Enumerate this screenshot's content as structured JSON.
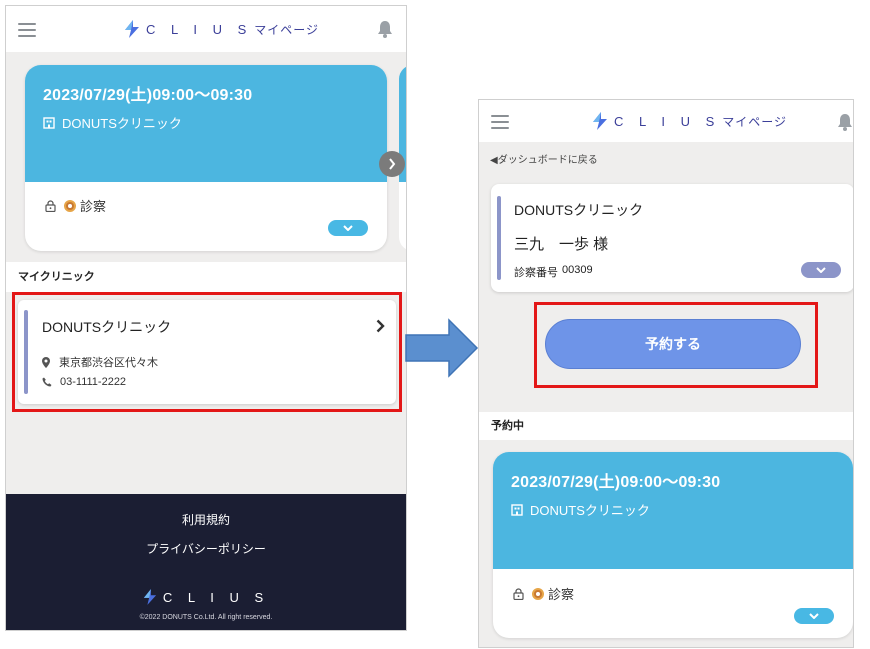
{
  "left_screen": {
    "header": {
      "brand_wordmark": "C L I U S",
      "brand_sub": "マイページ"
    },
    "appointment": {
      "datetime": "2023/07/29(土)09:00～09:30",
      "clinic": "DONUTSクリニック",
      "type": "診察"
    },
    "my_clinic_section": "マイクリニック",
    "clinic_card": {
      "name": "DONUTSクリニック",
      "address": "東京都渋谷区代々木",
      "phone": "03-1111-2222"
    },
    "footer": {
      "terms": "利用規約",
      "privacy": "プライバシーポリシー",
      "logo": "C L I U S",
      "copyright": "©2022 DONUTS Co.Ltd. All right reserved."
    }
  },
  "right_screen": {
    "header": {
      "brand_wordmark": "C L I U S",
      "brand_sub": "マイページ"
    },
    "back_link": "◀ダッシュボードに戻る",
    "patient_card": {
      "clinic": "DONUTSクリニック",
      "patient_name": "三九　一歩 様",
      "exam_number_label": "診察番号",
      "exam_number": "00309"
    },
    "reserve_button": "予約する",
    "reserved_section": "予約中",
    "appointment": {
      "datetime": "2023/07/29(土)09:00～09:30",
      "clinic": "DONUTSクリニック",
      "type": "診察"
    }
  },
  "colors": {
    "appointment_blue": "#4cb6e0",
    "brand": "#3b3f99",
    "highlight_red": "#e31717",
    "arrow_blue": "#5b8fcf",
    "reserve_button": "#6e94e8",
    "footer": "#1b1e33"
  }
}
